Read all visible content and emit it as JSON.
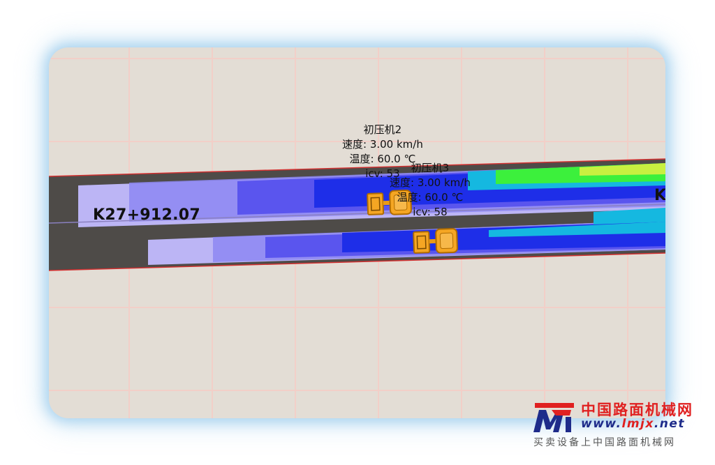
{
  "map": {
    "station_label": "K27+912.07",
    "edge_label": "K",
    "vehicles": [
      {
        "name": "初压机2",
        "speed": "速度: 3.00 km/h",
        "temperature": "温度: 60.0 ℃",
        "icv": "icv: 53"
      },
      {
        "name": "初压机3",
        "speed": "速度: 3.00 km/h",
        "temperature": "温度: 60.0 ℃",
        "icv": "icv: 58"
      }
    ],
    "colors": {
      "background": "#e3ddd5",
      "grid": "#f2cfc8",
      "road_uncompacted": "#4e4b48",
      "pass_1": "#bcb5f5",
      "pass_2": "#6f6af0",
      "pass_3": "#1e2ee8",
      "pass_4": "#15b8e0",
      "pass_5": "#3cf03c",
      "roller": "#f5a623",
      "road_edge": "#d23030"
    }
  },
  "watermark": {
    "title": "中国路面机械网",
    "url_prefix": "www.",
    "url_brand": "lmjx",
    "url_suffix": ".net",
    "tagline": "买卖设备上中国路面机械网",
    "logo_icon": "lmjx-logo-icon"
  }
}
